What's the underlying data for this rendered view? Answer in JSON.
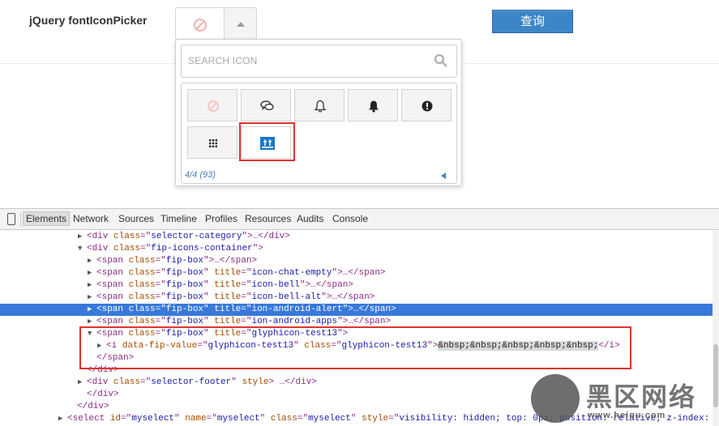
{
  "demo": {
    "label": "jQuery fontIconPicker",
    "query_button": "查询"
  },
  "picker": {
    "search_placeholder": "SEARCH ICON",
    "paging": "4/4 (93)",
    "icons": [
      {
        "name": "ban-icon"
      },
      {
        "name": "chat-icon"
      },
      {
        "name": "bell-outline-icon"
      },
      {
        "name": "bell-icon"
      },
      {
        "name": "alert-icon"
      },
      {
        "name": "apps-grid-icon"
      },
      {
        "name": "glyphicon-test13-icon"
      }
    ],
    "colors": {
      "selected_frame": "#e0322e",
      "accent": "#3c86c8"
    }
  },
  "devtools": {
    "tabs": [
      "Elements",
      "Network",
      "Sources",
      "Timeline",
      "Profiles",
      "Resources",
      "Audits",
      "Console"
    ],
    "active_tab": "Elements",
    "lines": [
      {
        "tri": "▶",
        "indent": 96,
        "parts": [
          [
            "tag",
            "<div "
          ],
          [
            "an",
            "class"
          ],
          [
            "tag",
            "=\""
          ],
          [
            "av",
            "selector-category"
          ],
          [
            "tag",
            "\">"
          ],
          [
            "t",
            "…"
          ],
          [
            "tag",
            "</div>"
          ]
        ]
      },
      {
        "tri": "▼",
        "indent": 96,
        "parts": [
          [
            "tag",
            "<div "
          ],
          [
            "an",
            "class"
          ],
          [
            "tag",
            "=\""
          ],
          [
            "av",
            "fip-icons-container"
          ],
          [
            "tag",
            "\">"
          ]
        ]
      },
      {
        "tri": "▶",
        "indent": 108,
        "parts": [
          [
            "tag",
            "<span "
          ],
          [
            "an",
            "class"
          ],
          [
            "tag",
            "=\""
          ],
          [
            "av",
            "fip-box"
          ],
          [
            "tag",
            "\">"
          ],
          [
            "t",
            "…"
          ],
          [
            "tag",
            "</span>"
          ]
        ]
      },
      {
        "tri": "▶",
        "indent": 108,
        "parts": [
          [
            "tag",
            "<span "
          ],
          [
            "an",
            "class"
          ],
          [
            "tag",
            "=\""
          ],
          [
            "av",
            "fip-box"
          ],
          [
            "tag",
            "\" "
          ],
          [
            "an",
            "title"
          ],
          [
            "tag",
            "=\""
          ],
          [
            "av",
            "icon-chat-empty"
          ],
          [
            "tag",
            "\">"
          ],
          [
            "t",
            "…"
          ],
          [
            "tag",
            "</span>"
          ]
        ]
      },
      {
        "tri": "▶",
        "indent": 108,
        "parts": [
          [
            "tag",
            "<span "
          ],
          [
            "an",
            "class"
          ],
          [
            "tag",
            "=\""
          ],
          [
            "av",
            "fip-box"
          ],
          [
            "tag",
            "\" "
          ],
          [
            "an",
            "title"
          ],
          [
            "tag",
            "=\""
          ],
          [
            "av",
            "icon-bell"
          ],
          [
            "tag",
            "\">"
          ],
          [
            "t",
            "…"
          ],
          [
            "tag",
            "</span>"
          ]
        ]
      },
      {
        "tri": "▶",
        "indent": 108,
        "parts": [
          [
            "tag",
            "<span "
          ],
          [
            "an",
            "class"
          ],
          [
            "tag",
            "=\""
          ],
          [
            "av",
            "fip-box"
          ],
          [
            "tag",
            "\" "
          ],
          [
            "an",
            "title"
          ],
          [
            "tag",
            "=\""
          ],
          [
            "av",
            "icon-bell-alt"
          ],
          [
            "tag",
            "\">"
          ],
          [
            "t",
            "…"
          ],
          [
            "tag",
            "</span>"
          ]
        ]
      },
      {
        "tri": "▶",
        "indent": 108,
        "hl": true,
        "parts": [
          [
            "tag",
            "<span "
          ],
          [
            "an",
            "class"
          ],
          [
            "tag",
            "=\""
          ],
          [
            "av",
            "fip-box"
          ],
          [
            "tag",
            "\" "
          ],
          [
            "an",
            "title"
          ],
          [
            "tag",
            "=\""
          ],
          [
            "av",
            "ion-android-alert"
          ],
          [
            "tag",
            "\">"
          ],
          [
            "t",
            "…"
          ],
          [
            "tag",
            "</span>"
          ]
        ]
      },
      {
        "tri": "▶",
        "indent": 108,
        "parts": [
          [
            "tag",
            "<span "
          ],
          [
            "an",
            "class"
          ],
          [
            "tag",
            "=\""
          ],
          [
            "av",
            "fip-box"
          ],
          [
            "tag",
            "\" "
          ],
          [
            "an",
            "title"
          ],
          [
            "tag",
            "=\""
          ],
          [
            "av",
            "ion-android-apps"
          ],
          [
            "tag",
            "\">"
          ],
          [
            "t",
            "…"
          ],
          [
            "tag",
            "</span>"
          ]
        ]
      },
      {
        "tri": "▼",
        "indent": 108,
        "parts": [
          [
            "tag",
            "<span "
          ],
          [
            "an",
            "class"
          ],
          [
            "tag",
            "=\""
          ],
          [
            "av",
            "fip-box"
          ],
          [
            "tag",
            "\" "
          ],
          [
            "an",
            "title"
          ],
          [
            "tag",
            "=\""
          ],
          [
            "av",
            "glyphicon-test13"
          ],
          [
            "tag",
            "\">"
          ]
        ]
      },
      {
        "tri": "▶",
        "indent": 120,
        "parts": [
          [
            "tag",
            "<i "
          ],
          [
            "an",
            "data-fip-value"
          ],
          [
            "tag",
            "=\""
          ],
          [
            "av",
            "glyphicon-test13"
          ],
          [
            "tag",
            "\" "
          ],
          [
            "an",
            "class"
          ],
          [
            "tag",
            "=\""
          ],
          [
            "av",
            "glyphicon-test13"
          ],
          [
            "tag",
            "\">"
          ],
          [
            "nb",
            "&nbsp;&nbsp;&nbsp;&nbsp;&nbsp;"
          ],
          [
            "tag",
            "</i>"
          ]
        ]
      },
      {
        "tri": "",
        "indent": 108,
        "parts": [
          [
            "tag",
            "</span>"
          ]
        ]
      },
      {
        "tri": "",
        "indent": 96,
        "parts": [
          [
            "tag",
            "</div>"
          ]
        ]
      },
      {
        "tri": "▶",
        "indent": 96,
        "parts": [
          [
            "tag",
            "<div "
          ],
          [
            "an",
            "class"
          ],
          [
            "tag",
            "=\""
          ],
          [
            "av",
            "selector-footer"
          ],
          [
            "tag",
            "\" "
          ],
          [
            "an",
            "style"
          ],
          [
            "tag",
            "> "
          ],
          [
            "t",
            "…"
          ],
          [
            "tag",
            "</div>"
          ]
        ]
      },
      {
        "tri": "",
        "indent": 96,
        "parts": [
          [
            "tag",
            "</div>"
          ]
        ]
      },
      {
        "tri": "",
        "indent": 84,
        "parts": [
          [
            "tag",
            "</div>"
          ]
        ]
      },
      {
        "tri": "▶",
        "indent": 72,
        "parts": [
          [
            "tag",
            "<select "
          ],
          [
            "an",
            "id"
          ],
          [
            "tag",
            "=\""
          ],
          [
            "av",
            "myselect"
          ],
          [
            "tag",
            "\" "
          ],
          [
            "an",
            "name"
          ],
          [
            "tag",
            "=\""
          ],
          [
            "av",
            "myselect"
          ],
          [
            "tag",
            "\" "
          ],
          [
            "an",
            "class"
          ],
          [
            "tag",
            "=\""
          ],
          [
            "av",
            "myselect"
          ],
          [
            "tag",
            "\" "
          ],
          [
            "an",
            "style"
          ],
          [
            "tag",
            "=\""
          ],
          [
            "av",
            "visibility: hidden; top: 0px; position: relative; z-index:"
          ]
        ]
      }
    ]
  },
  "watermark": {
    "text": "黑区网络",
    "url": "www.heiqu.com"
  }
}
